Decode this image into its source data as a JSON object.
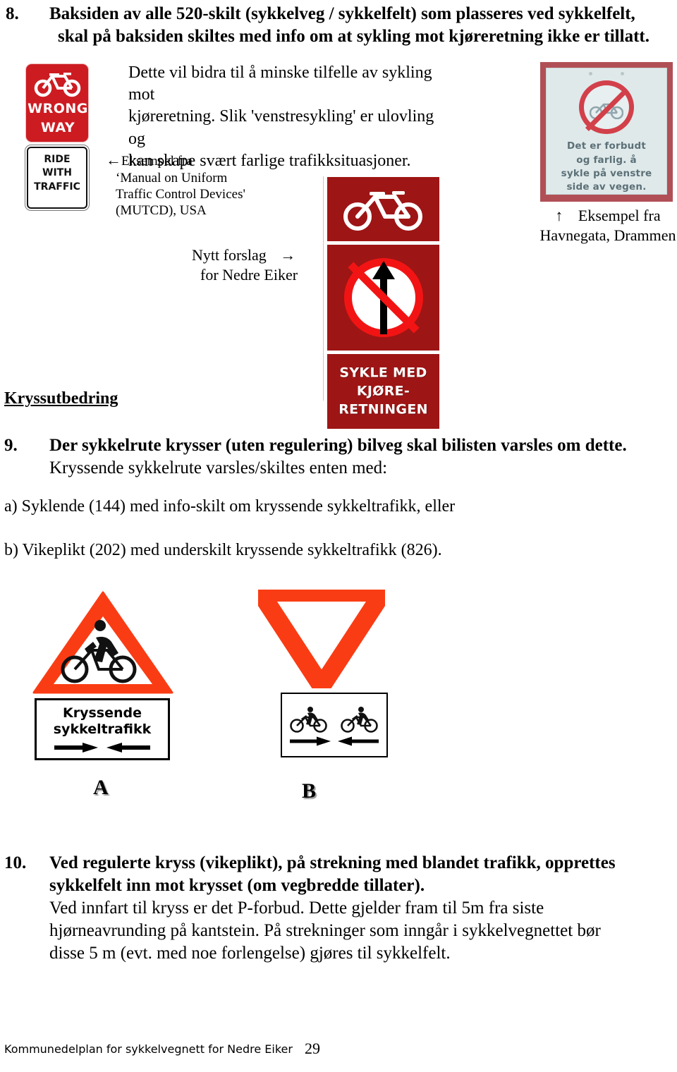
{
  "document": {
    "footer_text": "Kommunedelplan for sykkelvegnett for Nedre Eiker",
    "page_number": "29"
  },
  "items": {
    "item8": {
      "number": "8.",
      "line1": "Baksiden av alle 520-skilt (sykkelveg / sykkelfelt) som plasseres ved sykkelfelt,",
      "line2": "skal på baksiden skiltes med info om at sykling mot kjøreretning ikke er tillatt."
    },
    "item9": {
      "number": "9.",
      "line1": "Der sykkelrute krysser (uten regulering) bilveg skal bilisten varsles om dette.",
      "line2": "Kryssende sykkelrute varsles/skiltes enten med:",
      "option_a": "a)  Syklende (144) med info-skilt om kryssende sykkeltrafikk,  eller",
      "option_b": "b)  Vikeplikt (202) med underskilt kryssende sykkeltrafikk (826)."
    },
    "item10": {
      "number": "10.",
      "line1": "Ved regulerte kryss (vikeplikt), på strekning med blandet trafikk, opprettes",
      "line2": "sykkelfelt inn mot krysset  (om vegbredde tillater).",
      "line3": "Ved innfart til kryss er det P-forbud. Dette gjelder fram til 5m fra siste",
      "line4": "hjørneavrunding på  kantstein. På strekninger som inngår i sykkelvegnettet bør",
      "line5": "disse 5 m (evt. med noe forlengelse) gjøres til sykkelfelt."
    }
  },
  "body_paragraph": {
    "line1": "Dette vil bidra til å minske tilfelle av sykling mot",
    "line2": "kjøreretning. Slik 'venstresykling'  er ulovling og",
    "line3": "kan skape svært farlige trafikksituasjoner."
  },
  "section_heading": "Kryssutbedring",
  "captions": {
    "mutcd": {
      "arrow": "←",
      "line1": "Eksempel fra",
      "line2": "‘Manual on Uniform",
      "line3": "Traffic Control Devices'",
      "line4": "(MUTCD), USA"
    },
    "proposal": {
      "line1": "Nytt forslag",
      "line2": "for Nedre Eiker",
      "arrow": "→"
    },
    "havnegata": {
      "arrow": "↑",
      "line1": "Eksempel fra",
      "line2": "Havnegata, Drammen"
    },
    "label_a": "A",
    "label_b": "B"
  },
  "signs": {
    "mutcd_sign": {
      "word1": "WRONG",
      "word2": "WAY",
      "sub_line1": "RIDE",
      "sub_line2": "WITH",
      "sub_line3": "TRAFFIC",
      "red": "#CC1C22"
    },
    "havnegata_sign": {
      "line1": "Det er forbudt",
      "line2": "og farlig. å",
      "line3": "sykle på venstre",
      "line4": "side av vegen.",
      "frame_color": "#B05056",
      "face_color": "#dfe9ea"
    },
    "proposal_sign": {
      "text_line1": "SYKLE MED",
      "text_line2": "KJØRE-",
      "text_line3": "RETNINGEN",
      "red": "#9E1515",
      "prohibition_red": "#F21414"
    },
    "sign_a": {
      "plate_line1": "Kryssende",
      "plate_line2": "sykkeltrafikk",
      "triangle_red": "#FA3C14"
    },
    "sign_b": {
      "triangle_red": "#FA3C14"
    }
  }
}
